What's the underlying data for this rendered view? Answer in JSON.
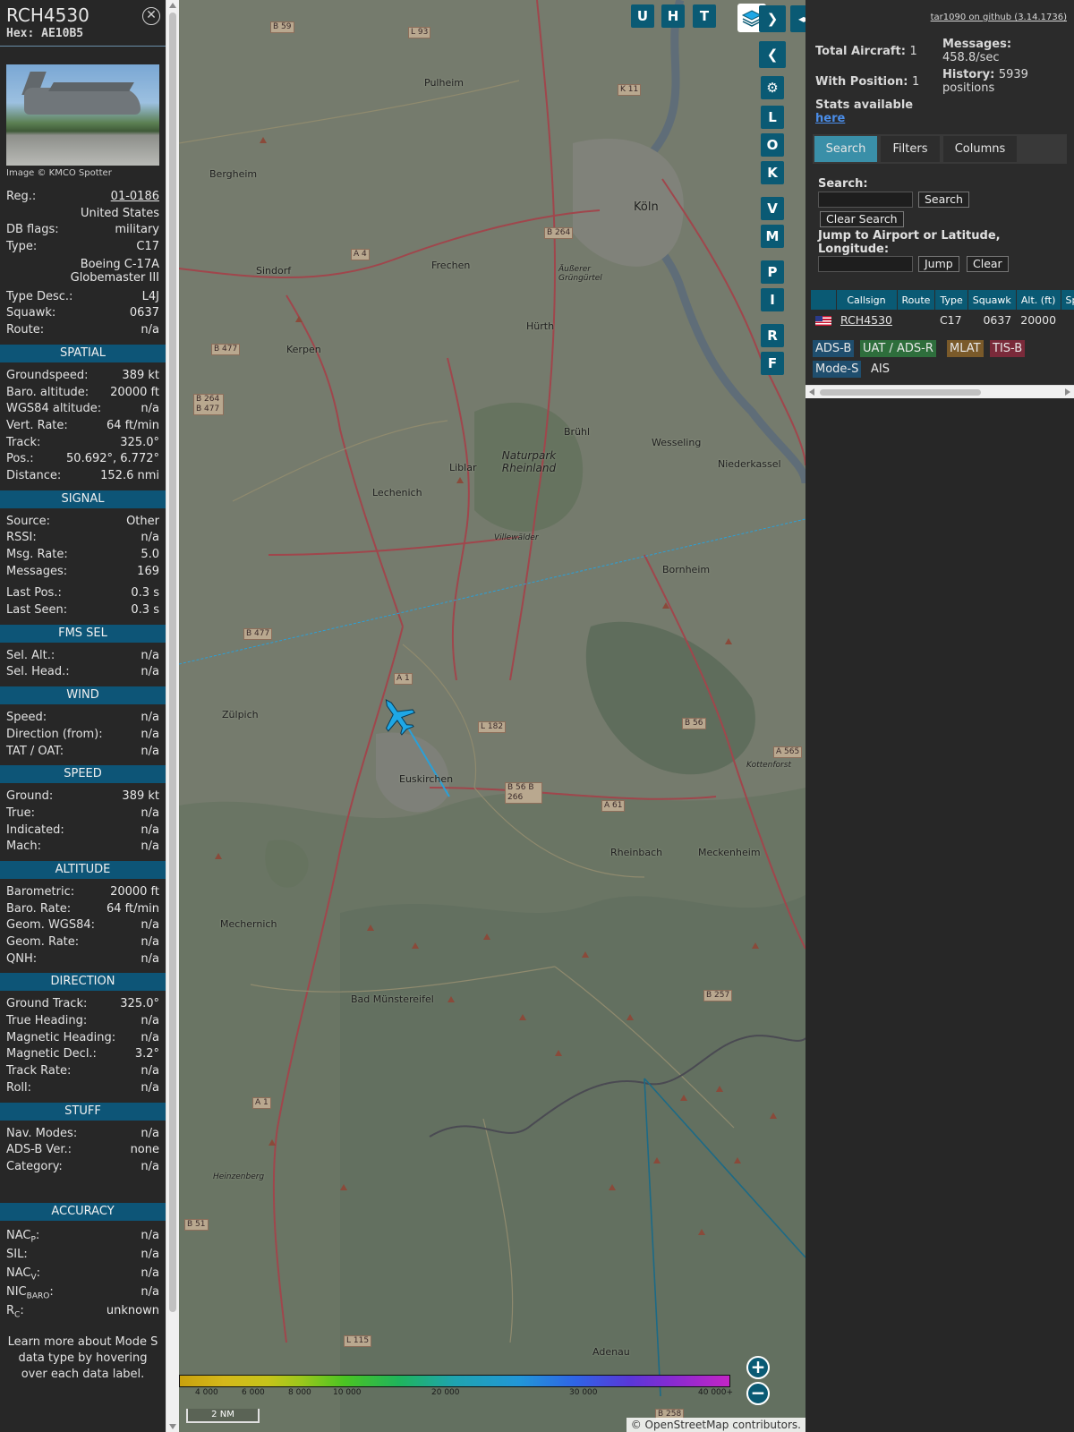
{
  "info": {
    "callsign": "RCH4530",
    "hex": "Hex: AE10B5",
    "photo_credit": "Image © KMCO Spotter",
    "details": [
      {
        "label": "Reg.:",
        "value": "01-0186"
      },
      {
        "label": "",
        "value": "United States"
      },
      {
        "label": "DB flags:",
        "value": "military"
      },
      {
        "label": "Type:",
        "value": "C17"
      },
      {
        "label": "",
        "value": "Boeing C-17A Globemaster III"
      },
      {
        "label": "Type Desc.:",
        "value": "L4J"
      },
      {
        "label": "Squawk:",
        "value": "0637"
      },
      {
        "label": "Route:",
        "value": "n/a"
      }
    ],
    "spatial": {
      "title": "SPATIAL",
      "rows": [
        {
          "label": "Groundspeed:",
          "value": "389 kt"
        },
        {
          "label": "Baro. altitude:",
          "value": "20000 ft"
        },
        {
          "label": "WGS84 altitude:",
          "value": "n/a"
        },
        {
          "label": "Vert. Rate:",
          "value": "64 ft/min"
        },
        {
          "label": "Track:",
          "value": "325.0°"
        },
        {
          "label": "Pos.:",
          "value": "50.692°, 6.772°"
        },
        {
          "label": "Distance:",
          "value": "152.6 nmi"
        }
      ]
    },
    "signal": {
      "title": "SIGNAL",
      "rows": [
        {
          "label": "Source:",
          "value": "Other"
        },
        {
          "label": "RSSI:",
          "value": "n/a"
        },
        {
          "label": "Msg. Rate:",
          "value": "5.0"
        },
        {
          "label": "Messages:",
          "value": "169"
        },
        {
          "label": "Last Pos.:",
          "value": "0.3 s"
        },
        {
          "label": "Last Seen:",
          "value": "0.3 s"
        }
      ]
    },
    "fms": {
      "title": "FMS SEL",
      "rows": [
        {
          "label": "Sel. Alt.:",
          "value": "n/a"
        },
        {
          "label": "Sel. Head.:",
          "value": "n/a"
        }
      ]
    },
    "wind": {
      "title": "WIND",
      "rows": [
        {
          "label": "Speed:",
          "value": "n/a"
        },
        {
          "label": "Direction (from):",
          "value": "n/a"
        },
        {
          "label": "TAT / OAT:",
          "value": "n/a"
        }
      ]
    },
    "speed": {
      "title": "SPEED",
      "rows": [
        {
          "label": "Ground:",
          "value": "389 kt"
        },
        {
          "label": "True:",
          "value": "n/a"
        },
        {
          "label": "Indicated:",
          "value": "n/a"
        },
        {
          "label": "Mach:",
          "value": "n/a"
        }
      ]
    },
    "altitude": {
      "title": "ALTITUDE",
      "rows": [
        {
          "label": "Barometric:",
          "value": "20000 ft"
        },
        {
          "label": "Baro. Rate:",
          "value": "64 ft/min"
        },
        {
          "label": "Geom. WGS84:",
          "value": "n/a"
        },
        {
          "label": "Geom. Rate:",
          "value": "n/a"
        },
        {
          "label": "QNH:",
          "value": "n/a"
        }
      ]
    },
    "direction": {
      "title": "DIRECTION",
      "rows": [
        {
          "label": "Ground Track:",
          "value": "325.0°"
        },
        {
          "label": "True Heading:",
          "value": "n/a"
        },
        {
          "label": "Magnetic Heading:",
          "value": "n/a"
        },
        {
          "label": "Magnetic Decl.:",
          "value": "3.2°"
        },
        {
          "label": "Track Rate:",
          "value": "n/a"
        },
        {
          "label": "Roll:",
          "value": "n/a"
        }
      ]
    },
    "stuff": {
      "title": "STUFF",
      "rows": [
        {
          "label": "Nav. Modes:",
          "value": "n/a"
        },
        {
          "label": "ADS-B Ver.:",
          "value": "none"
        },
        {
          "label": "Category:",
          "value": "n/a"
        }
      ]
    },
    "accuracy": {
      "title": "ACCURACY",
      "rows": [
        {
          "label": "NAC",
          "sub": "P",
          "value": "n/a"
        },
        {
          "label": "SIL",
          "sub": "",
          "value": "n/a"
        },
        {
          "label": "NAC",
          "sub": "V",
          "value": "n/a"
        },
        {
          "label": "NIC",
          "sub": "BARO",
          "value": "n/a"
        },
        {
          "label": "R",
          "sub": "C",
          "value": "unknown"
        }
      ]
    },
    "learn_more": "Learn more about Mode S data type by hovering over each data label."
  },
  "map": {
    "buttons": [
      "U",
      "H",
      "T",
      "L",
      "O",
      "K",
      "V",
      "M",
      "P",
      "I",
      "R",
      "F"
    ],
    "places": [
      {
        "name": "Pulheim"
      },
      {
        "name": "Bergheim"
      },
      {
        "name": "Köln"
      },
      {
        "name": "Frechen"
      },
      {
        "name": "Sindorf"
      },
      {
        "name": "Hürth"
      },
      {
        "name": "Kerpen"
      },
      {
        "name": "Brühl"
      },
      {
        "name": "Wesseling"
      },
      {
        "name": "Niederkassel"
      },
      {
        "name": "Liblar"
      },
      {
        "name": "Lechenich"
      },
      {
        "name": "Naturpark Rheinland"
      },
      {
        "name": "Bornheim"
      },
      {
        "name": "Zülpich"
      },
      {
        "name": "Euskirchen"
      },
      {
        "name": "Rheinbach"
      },
      {
        "name": "Meckenheim"
      },
      {
        "name": "Mechernich"
      },
      {
        "name": "Bad Münstereifel"
      },
      {
        "name": "Heinzenberg"
      },
      {
        "name": "Adenau"
      },
      {
        "name": "Äußerer Grüngürtel"
      },
      {
        "name": "Villewälder"
      },
      {
        "name": "Kottenforst"
      }
    ],
    "roads": [
      "B 59",
      "L 93",
      "K 11",
      "A 4",
      "B 264",
      "B 477",
      "B 264 B 477",
      "B 477",
      "A 1",
      "L 182",
      "B 56 B 266",
      "A 61",
      "B 56",
      "A 565",
      "B 257",
      "A 1",
      "B 51",
      "L 115",
      "B 258"
    ],
    "altitude_ticks": [
      "4 000",
      "6 000",
      "8 000",
      "10 000",
      "20 000",
      "30 000",
      "40 000+"
    ],
    "scale": "2 NM",
    "attribution": "© OpenStreetMap contributors."
  },
  "sidebar": {
    "github": "tar1090 on github (3.14.1736)",
    "total_aircraft_label": "Total Aircraft:",
    "total_aircraft": "1",
    "with_position_label": "With Position:",
    "with_position": "1",
    "stats_label": "Stats available",
    "stats_link": "here",
    "messages_label": "Messages:",
    "messages": "458.8/sec",
    "history_label": "History:",
    "history": "5939 positions",
    "tabs": [
      "Search",
      "Filters",
      "Columns"
    ],
    "search_label": "Search:",
    "search_button": "Search",
    "clear_search_button": "Clear Search",
    "jump_label": "Jump to Airport or Latitude, Longitude:",
    "jump_button": "Jump",
    "clear_button": "Clear",
    "table": {
      "headers": [
        "Callsign",
        "Route",
        "Type",
        "Squawk",
        "Alt. (ft)",
        "Spd"
      ],
      "rows": [
        {
          "callsign": "RCH4530",
          "route": "",
          "type": "C17",
          "squawk": "0637",
          "alt": "20000",
          "spd": ""
        }
      ]
    },
    "sources": [
      "ADS-B",
      "UAT / ADS-R",
      "MLAT",
      "TIS-B",
      "Mode-S",
      "AIS"
    ]
  },
  "colors": {
    "accent": "#0a5a74",
    "tab_active": "#3a8fa8",
    "track": "#2aa0d8",
    "plane": "#1ea7e6",
    "adsb": "#1f4e6e",
    "uat": "#2e6e3c",
    "mlat": "#7a5a2a",
    "tisb": "#7a2a3a",
    "modes": "#1f4e6e"
  }
}
